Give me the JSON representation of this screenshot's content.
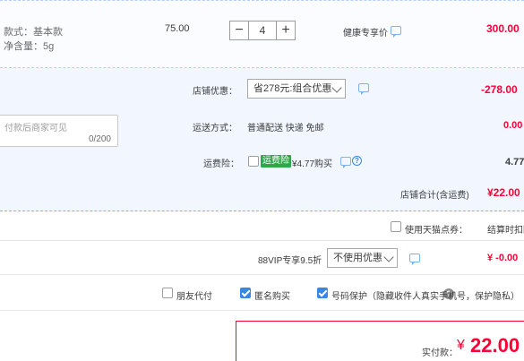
{
  "item": {
    "style_label": "款式：基本款",
    "net_content_label": "净含量：5g",
    "unit_price": "75.00",
    "quantity": "4",
    "minus": "−",
    "plus": "+",
    "discount_label": "健康专享价",
    "total": "300.00"
  },
  "order": {
    "memo_placeholder": "付款后商家可见",
    "memo_count": "0/200",
    "shop_discount_label": "店铺优惠：",
    "shop_discount_option": "省278元:组合优惠",
    "shop_discount_value": "-278.00",
    "shipping_label": "运送方式：",
    "shipping_method": "普通配送 快递 免邮",
    "shipping_fee": "0.00",
    "insurance_label": "运费险：",
    "insurance_badge": "运费险",
    "insurance_price": "¥4.77购买",
    "insurance_help": "?",
    "insurance_value": "4.77",
    "shop_total_label": "店铺合计(含运费)",
    "shop_total_value": "¥22.00"
  },
  "points": {
    "use_points_label": "使用天猫点券：",
    "settle_label": "结算时扣除"
  },
  "vip": {
    "label": "88VIP专享9.5折",
    "option": "不使用优惠",
    "value": "¥ -0.00"
  },
  "options": {
    "friend_pay": "朋友代付",
    "anonymous": "匿名购买",
    "number_protect": "号码保护（隐藏收件人真实手机号，保护隐私）",
    "help": "?"
  },
  "payment": {
    "label": "实付款：",
    "currency": "¥",
    "amount": "22.00"
  },
  "colors": {
    "accent_red": "#ff0036",
    "accent_blue": "#3b86e5",
    "badge_green": "#2ea84a"
  },
  "icons": [
    "chat-icon",
    "checkbox-icon",
    "help-icon",
    "chevron-down-icon"
  ]
}
